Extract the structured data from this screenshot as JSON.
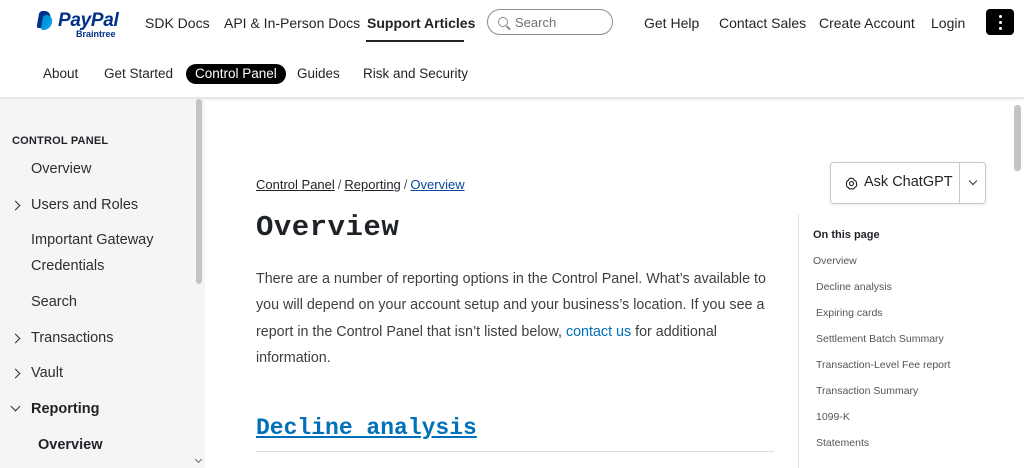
{
  "header": {
    "logo_text": "PayPal",
    "logo_sub": "Braintree",
    "nav": {
      "sdk_docs": "SDK Docs",
      "api_docs": "API & In-Person Docs",
      "support_articles": "Support Articles",
      "get_help": "Get Help",
      "contact_sales": "Contact Sales",
      "create_account": "Create Account",
      "login": "Login"
    },
    "search_placeholder": "Search"
  },
  "subnav": {
    "items": [
      "About",
      "Get Started",
      "Control Panel",
      "Guides",
      "Risk and Security"
    ],
    "active": "Control Panel"
  },
  "sidebar": {
    "title": "CONTROL PANEL",
    "items": [
      {
        "label": "Overview",
        "chevron": "none"
      },
      {
        "label": "Users and Roles",
        "chevron": "right"
      },
      {
        "label": "Important Gateway",
        "chevron": "none"
      },
      {
        "label": "Credentials",
        "chevron": "none"
      },
      {
        "label": "Search",
        "chevron": "none"
      },
      {
        "label": "Transactions",
        "chevron": "right"
      },
      {
        "label": "Vault",
        "chevron": "right"
      },
      {
        "label": "Reporting",
        "chevron": "down"
      },
      {
        "label": "Overview",
        "chevron": "none"
      }
    ]
  },
  "breadcrumb": {
    "items": [
      "Control Panel",
      "Reporting",
      "Overview"
    ],
    "separator": "/"
  },
  "main": {
    "title": "Overview",
    "intro_before_link": "There are a number of reporting options in the Control Panel. What’s available to you will depend on your account setup and your business’s location. If you see a report in the Control Panel that isn’t listed below, ",
    "intro_link": "contact us",
    "intro_after_link": " for additional information.",
    "section_heading": "Decline analysis"
  },
  "ask_button": {
    "label": "Ask ChatGPT"
  },
  "toc": {
    "title": "On this page",
    "items": [
      "Overview",
      "Decline analysis",
      "Expiring cards",
      "Settlement Batch Summary",
      "Transaction-Level Fee report",
      "Transaction Summary",
      "1099-K",
      "Statements"
    ]
  },
  "colors": {
    "link": "#0070ba",
    "brand_dark": "#003087",
    "brand_light": "#009cde",
    "sidebar_bg": "#f5f5f5"
  }
}
